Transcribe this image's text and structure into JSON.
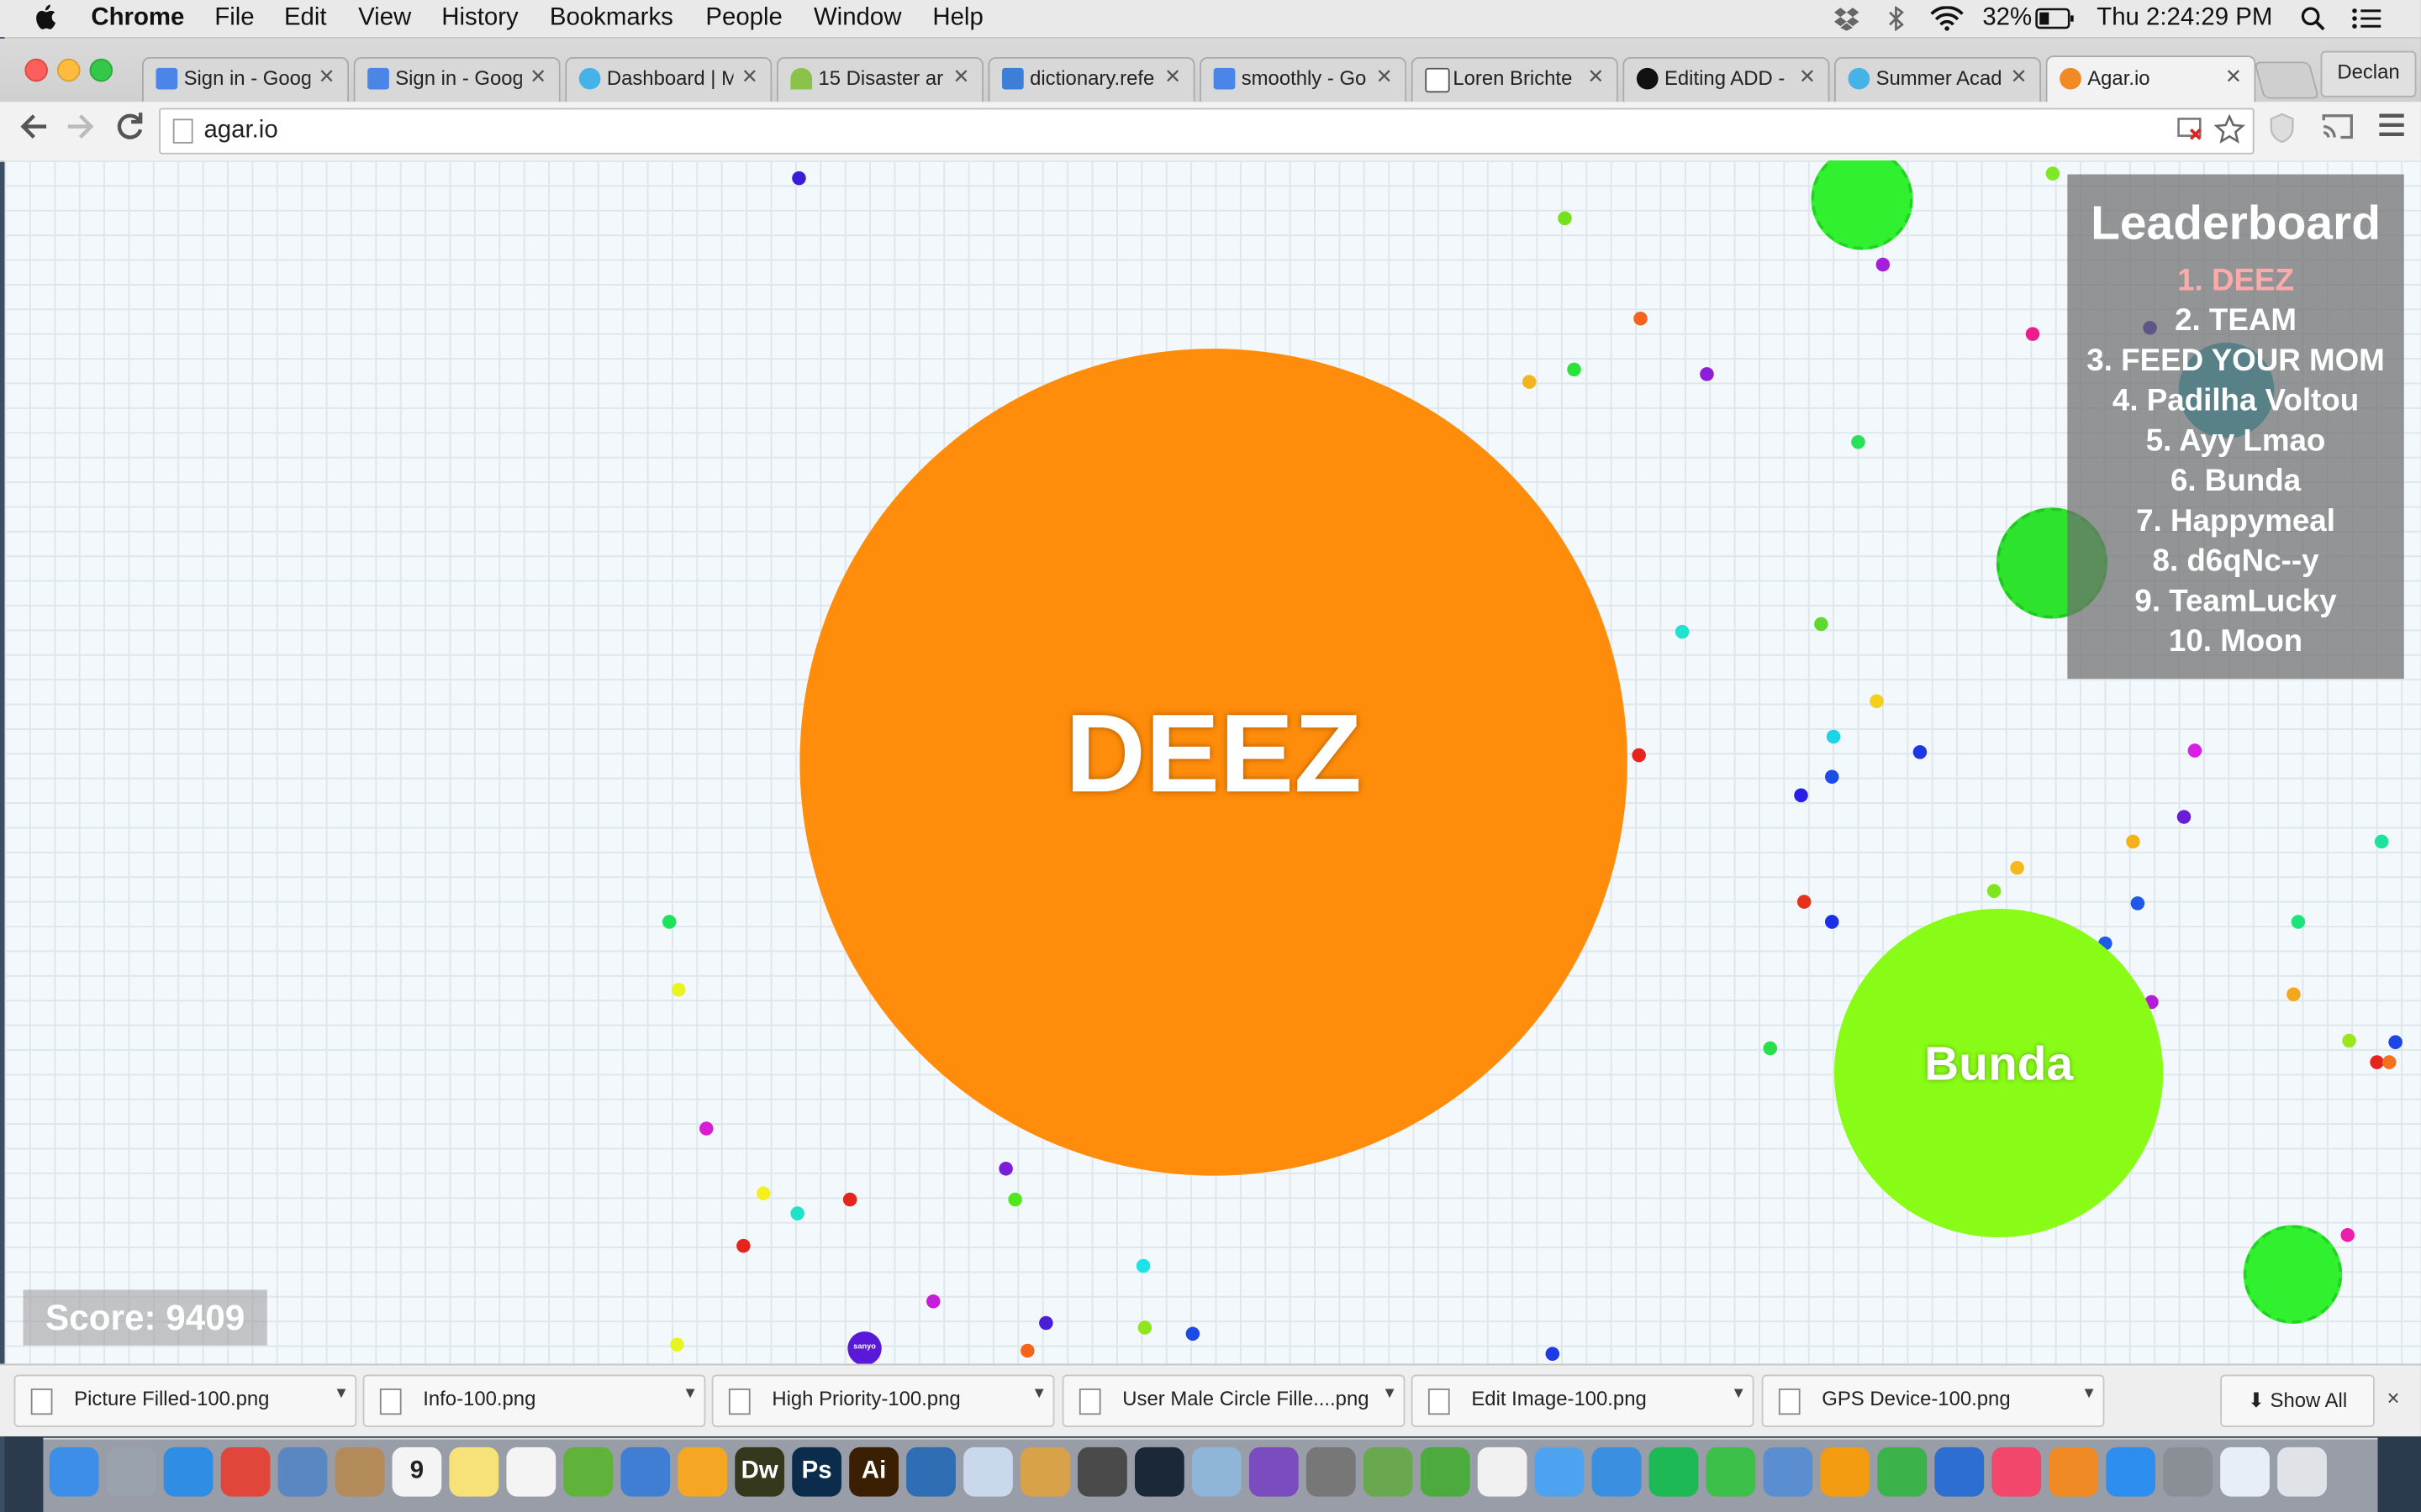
{
  "menubar": {
    "apple": "",
    "app": "Chrome",
    "menus": [
      "File",
      "Edit",
      "View",
      "History",
      "Bookmarks",
      "People",
      "Window",
      "Help"
    ],
    "battery": "32%",
    "clock": "Thu 2:24:29 PM"
  },
  "tabs": [
    {
      "title": "Sign in - Goog",
      "fav": "google-icon",
      "color": "#4a86e8"
    },
    {
      "title": "Sign in - Goog",
      "fav": "google-icon",
      "color": "#4a86e8"
    },
    {
      "title": "Dashboard | M",
      "fav": "gem-icon",
      "color": "#45b3e7"
    },
    {
      "title": "15 Disaster ar",
      "fav": "signal-icon",
      "color": "#8bc34a"
    },
    {
      "title": "dictionary.refe",
      "fav": "dictionary-icon",
      "color": "#3d7fd6"
    },
    {
      "title": "smoothly - Go",
      "fav": "google-icon",
      "color": "#4a86e8"
    },
    {
      "title": "Loren Brichte",
      "fav": "wsj-icon",
      "color": "#222222"
    },
    {
      "title": "Editing ADD -",
      "fav": "github-icon",
      "color": "#111111"
    },
    {
      "title": "Summer Acad",
      "fav": "gem-icon",
      "color": "#45b3e7"
    },
    {
      "title": "Agar.io",
      "fav": "agar-icon",
      "color": "#f08a24"
    }
  ],
  "profile": "Declan",
  "address": {
    "url": "agar.io"
  },
  "game": {
    "player": {
      "name": "DEEZ",
      "color": "#ff8c0a"
    },
    "enemy": {
      "name": "Bunda",
      "color": "#88fc16"
    },
    "mini_label": "sanyo",
    "leaderboard": {
      "title": "Leaderboard",
      "entries": [
        "1. DEEZ",
        "2. TEAM",
        "3. FEED YOUR MOM",
        "4. Padilha Voltou",
        "5. Ayy Lmao",
        "6. Bunda",
        "7. Happymeal",
        "8. d6qNc--y",
        "9. TeamLucky",
        "10. Moon"
      ],
      "highlight_color": "#ffaaaa"
    },
    "score": "Score: 9409"
  },
  "downloads": {
    "files": [
      "Picture Filled-100.png",
      "Info-100.png",
      "High Priority-100.png",
      "User Male Circle Fille....png",
      "Edit Image-100.png",
      "GPS Device-100.png"
    ],
    "show_all": "Show All",
    "close": "×"
  },
  "dock": {
    "apps": [
      {
        "name": "finder-icon",
        "color": "#3d8ee8",
        "label": ""
      },
      {
        "name": "launchpad-icon",
        "color": "#9aa3ad",
        "label": ""
      },
      {
        "name": "safari-icon",
        "color": "#2f8de4",
        "label": ""
      },
      {
        "name": "chrome-icon",
        "color": "#e0463a",
        "label": ""
      },
      {
        "name": "preview-icon",
        "color": "#5a87c2",
        "label": ""
      },
      {
        "name": "contacts-icon",
        "color": "#b38b5a",
        "label": ""
      },
      {
        "name": "calendar-icon",
        "color": "#f4f4f4",
        "label": "9"
      },
      {
        "name": "notes-icon",
        "color": "#f7e27a",
        "label": ""
      },
      {
        "name": "reminders-icon",
        "color": "#f4f4f4",
        "label": ""
      },
      {
        "name": "evernote-icon",
        "color": "#5fb33b",
        "label": ""
      },
      {
        "name": "xcode-icon",
        "color": "#3f7fd3",
        "label": ""
      },
      {
        "name": "sketch-icon",
        "color": "#f5a623",
        "label": ""
      },
      {
        "name": "dreamweaver-icon",
        "color": "#35381c",
        "label": "Dw"
      },
      {
        "name": "photoshop-icon",
        "color": "#0b2c4a",
        "label": "Ps"
      },
      {
        "name": "illustrator-icon",
        "color": "#3b1f03",
        "label": "Ai"
      },
      {
        "name": "screen-icon",
        "color": "#2f6db5",
        "label": ""
      },
      {
        "name": "penguin-icon",
        "color": "#c9d8ea",
        "label": ""
      },
      {
        "name": "mascot-icon",
        "color": "#d9a24a",
        "label": ""
      },
      {
        "name": "sublime-icon",
        "color": "#4a4a4a",
        "label": ""
      },
      {
        "name": "steam-icon",
        "color": "#1b2838",
        "label": ""
      },
      {
        "name": "image-viewer-icon",
        "color": "#8fb5d8",
        "label": ""
      },
      {
        "name": "imovie-icon",
        "color": "#7a4cc0",
        "label": ""
      },
      {
        "name": "photo-booth-icon",
        "color": "#777777",
        "label": ""
      },
      {
        "name": "earth-icon",
        "color": "#6aa84f",
        "label": ""
      },
      {
        "name": "utorrent-icon",
        "color": "#4bab3c",
        "label": ""
      },
      {
        "name": "photos-icon",
        "color": "#f0f0f0",
        "label": ""
      },
      {
        "name": "messages-icon",
        "color": "#4da3f0",
        "label": ""
      },
      {
        "name": "dropbox-icon",
        "color": "#3b8fe0",
        "label": ""
      },
      {
        "name": "spotify-icon",
        "color": "#1db954",
        "label": ""
      },
      {
        "name": "facetime-icon",
        "color": "#3cc04a",
        "label": ""
      },
      {
        "name": "textedit-icon",
        "color": "#5a8ed0",
        "label": ""
      },
      {
        "name": "pages-icon",
        "color": "#f39c12",
        "label": ""
      },
      {
        "name": "numbers-icon",
        "color": "#3bb34a",
        "label": ""
      },
      {
        "name": "keynote-icon",
        "color": "#2d6fd0",
        "label": ""
      },
      {
        "name": "itunes-icon",
        "color": "#f0476a",
        "label": ""
      },
      {
        "name": "ibooks-icon",
        "color": "#f08a24",
        "label": ""
      },
      {
        "name": "app-store-icon",
        "color": "#2d8ef0",
        "label": ""
      },
      {
        "name": "system-preferences-icon",
        "color": "#8a8f96",
        "label": ""
      },
      {
        "name": "documents-folder-icon",
        "color": "#e8eef6",
        "label": ""
      },
      {
        "name": "trash-icon",
        "color": "#dfe3e8",
        "label": ""
      }
    ]
  }
}
